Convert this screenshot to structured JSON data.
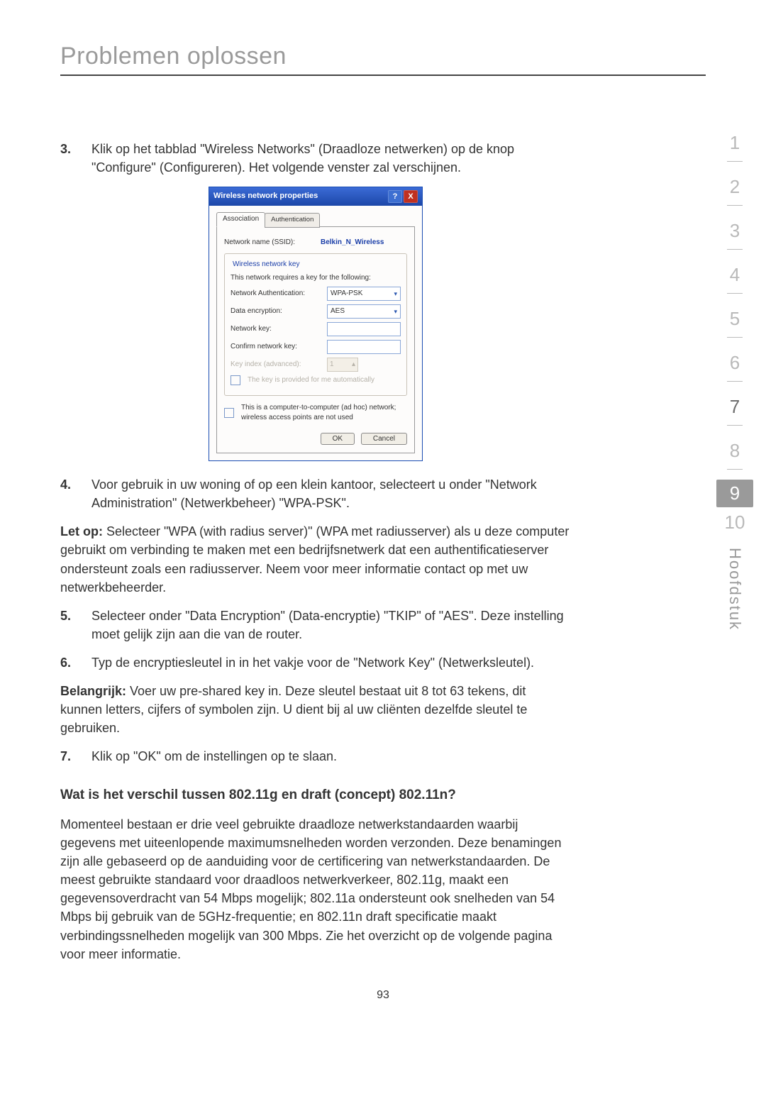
{
  "title": "Problemen oplossen",
  "pagenum": "93",
  "sidebar": {
    "items": [
      {
        "n": "1"
      },
      {
        "n": "2"
      },
      {
        "n": "3"
      },
      {
        "n": "4"
      },
      {
        "n": "5"
      },
      {
        "n": "6"
      },
      {
        "n": "7"
      },
      {
        "n": "8"
      },
      {
        "n": "9"
      },
      {
        "n": "10"
      }
    ],
    "active_index": 8,
    "label": "Hoofdstuk"
  },
  "steps": {
    "s3_num": "3.",
    "s3_txt": "Klik op het tabblad \"Wireless Networks\" (Draadloze netwerken) op de knop \"Configure\" (Configureren). Het volgende venster zal verschijnen.",
    "s4_num": "4.",
    "s4_txt": "Voor gebruik in uw woning of op een klein kantoor, selecteert u onder \"Network Administration\" (Netwerkbeheer) \"WPA-PSK\".",
    "note1_lead": "Let op:",
    "note1_txt": " Selecteer \"WPA (with radius server)\" (WPA met radiusserver) als u deze computer gebruikt om verbinding te maken met een bedrijfsnetwerk dat een authentificatieserver ondersteunt zoals een radiusserver. Neem voor meer informatie contact op met uw netwerkbeheerder.",
    "s5_num": "5.",
    "s5_txt": "Selecteer onder \"Data Encryption\" (Data-encryptie) \"TKIP\" of \"AES\". Deze instelling moet gelijk zijn aan die van de router.",
    "s6_num": "6.",
    "s6_txt": "Typ de encryptiesleutel in in het vakje voor de \"Network Key\" (Netwerksleutel).",
    "note2_lead": "Belangrijk:",
    "note2_txt": " Voer uw pre-shared key in. Deze sleutel bestaat uit 8 tot 63 tekens, dit kunnen letters, cijfers of symbolen zijn. U dient bij al uw cliënten dezelfde sleutel te gebruiken.",
    "s7_num": "7.",
    "s7_txt": "Klik op \"OK\" om de instellingen op te slaan."
  },
  "heading2": "Wat is het verschil tussen 802.11g en draft (concept) 802.11n?",
  "para2": "Momenteel bestaan er drie veel gebruikte draadloze netwerkstandaarden waarbij gegevens met uiteenlopende maximumsnelheden worden verzonden. Deze benamingen zijn alle gebaseerd op de aanduiding voor de certificering van netwerkstandaarden. De meest gebruikte standaard voor draadloos netwerkverkeer, 802.11g, maakt een gegevensoverdracht van 54 Mbps mogelijk; 802.11a ondersteunt ook snelheden van 54 Mbps bij gebruik van de 5GHz-frequentie; en 802.11n draft specificatie maakt verbindingssnelheden mogelijk van 300 Mbps. Zie het overzicht op de volgende pagina voor meer informatie.",
  "dialog": {
    "title": "Wireless network properties",
    "help": "?",
    "close": "X",
    "tab1": "Association",
    "tab2": "Authentication",
    "ssid_lbl": "Network name (SSID):",
    "ssid_val": "Belkin_N_Wireless",
    "fs_legend": "Wireless network key",
    "fs_text": "This network requires a key for the following:",
    "auth_lbl": "Network Authentication:",
    "auth_val": "WPA-PSK",
    "enc_lbl": "Data encryption:",
    "enc_val": "AES",
    "key_lbl": "Network key:",
    "ckey_lbl": "Confirm network key:",
    "idx_lbl": "Key index (advanced):",
    "idx_val": "1",
    "auto_lbl": "The key is provided for me automatically",
    "adhoc_lbl": "This is a computer-to-computer (ad hoc) network; wireless access points are not used",
    "ok": "OK",
    "cancel": "Cancel"
  }
}
